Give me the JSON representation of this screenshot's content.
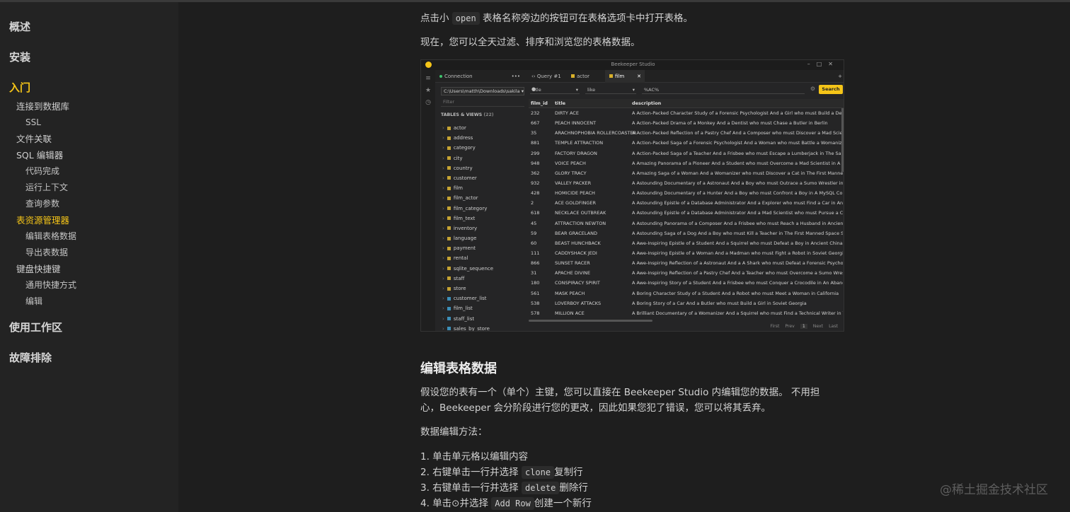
{
  "sidebar": {
    "sections": [
      {
        "label": "概述"
      },
      {
        "label": "安装"
      },
      {
        "label": "入门",
        "active": true
      }
    ],
    "intro_items": [
      {
        "label": "连接到数据库",
        "level": 1
      },
      {
        "label": "SSL",
        "level": 2
      },
      {
        "label": "文件关联",
        "level": 1
      },
      {
        "label": "SQL 编辑器",
        "level": 1
      },
      {
        "label": "代码完成",
        "level": 2
      },
      {
        "label": "运行上下文",
        "level": 2
      },
      {
        "label": "查询参数",
        "level": 2
      },
      {
        "label": "表资源管理器",
        "level": 1,
        "active": true
      },
      {
        "label": "编辑表格数据",
        "level": 2
      },
      {
        "label": "导出表数据",
        "level": 2
      },
      {
        "label": "键盘快捷键",
        "level": 1
      },
      {
        "label": "通用快捷方式",
        "level": 2
      },
      {
        "label": "编辑",
        "level": 2
      }
    ],
    "bottom_sections": [
      {
        "label": "使用工作区"
      },
      {
        "label": "故障排除"
      }
    ]
  },
  "content": {
    "p1_before": "点击小",
    "p1_code": "open",
    "p1_after": "表格名称旁边的按钮可在表格选项卡中打开表格。",
    "p2": "现在，您可以全天过滤、排序和浏览您的表格数据。",
    "heading": "编辑表格数据",
    "p3_line1": "假设您的表有一个（单个）主键，您可以直接在 Beekeeper Studio 内编辑您的数据。 不用担",
    "p3_line2": "心，Beekeeper 会分阶段进行您的更改，因此如果您犯了错误，您可以将其丢弃。",
    "p4": "数据编辑方法：",
    "list": {
      "i1": "1. 单击单元格以编辑内容",
      "i2_before": "2. 右键单击一行并选择",
      "i2_code": "clone",
      "i2_after": "复制行",
      "i3_before": "3. 右键单击一行并选择",
      "i3_code": "delete",
      "i3_after": "删除行",
      "i4_before": "4. 单击⊙并选择",
      "i4_code": "Add Row",
      "i4_after": "创建一个新行"
    }
  },
  "app": {
    "window_title": "Beekeeper Studio",
    "tabs": {
      "connection": "Connection",
      "more": "•••",
      "query": "‹› Query #1",
      "actor": "actor",
      "film": "film",
      "close": "✕",
      "plus": "+"
    },
    "path": "C:\\Users\\matth\\Downloads\\sakila",
    "filter_placeholder": "Filter",
    "tables_header": "TABLES & VIEWS",
    "tables_count": "(22)",
    "tables": [
      {
        "name": "actor",
        "view": false
      },
      {
        "name": "address",
        "view": false
      },
      {
        "name": "category",
        "view": false
      },
      {
        "name": "city",
        "view": false
      },
      {
        "name": "country",
        "view": false
      },
      {
        "name": "customer",
        "view": false
      },
      {
        "name": "film",
        "view": false
      },
      {
        "name": "film_actor",
        "view": false
      },
      {
        "name": "film_category",
        "view": false
      },
      {
        "name": "film_text",
        "view": false
      },
      {
        "name": "inventory",
        "view": false
      },
      {
        "name": "language",
        "view": false
      },
      {
        "name": "payment",
        "view": false
      },
      {
        "name": "rental",
        "view": false
      },
      {
        "name": "sqlite_sequence",
        "view": false
      },
      {
        "name": "staff",
        "view": false
      },
      {
        "name": "store",
        "view": false
      },
      {
        "name": "customer_list",
        "view": true
      },
      {
        "name": "film_list",
        "view": true
      },
      {
        "name": "staff_list",
        "view": true
      },
      {
        "name": "sales_by_store",
        "view": true
      }
    ],
    "query_bar": {
      "field": "title",
      "operator": "like",
      "value": "%AC%",
      "search_label": "Search"
    },
    "columns": [
      "film_id",
      "title",
      "description"
    ],
    "rows": [
      [
        "232",
        "DIRTY ACE",
        "A Action-Packed Character Study of a Forensic Psychologist And a Girl who must Build a Dentist in The Outback"
      ],
      [
        "667",
        "PEACH INNOCENT",
        "A Action-Packed Drama of a Monkey And a Dentist who must Chase a Butler in Berlin"
      ],
      [
        "35",
        "ARACHNOPHOBIA ROLLERCOASTER",
        "A Action-Packed Reflection of a Pastry Chef And a Composer who must Discover a Mad Scientist in The First Manned"
      ],
      [
        "881",
        "TEMPLE ATTRACTION",
        "A Action-Packed Saga of a Forensic Psychologist And a Woman who must Battle a Womanizer in Soviet Georgia"
      ],
      [
        "299",
        "FACTORY DRAGON",
        "A Action-Packed Saga of a Teacher And a Frisbee who must Escape a Lumberjack in The Sahara Desert"
      ],
      [
        "948",
        "VOICE PEACH",
        "A Amazing Panorama of a Pioneer And a Student who must Overcome a Mad Scientist in A Manhattan Penthouse"
      ],
      [
        "362",
        "GLORY TRACY",
        "A Amazing Saga of a Woman And a Womanizer who must Discover a Cat in The First Manned Space Station"
      ],
      [
        "932",
        "VALLEY PACKER",
        "A Astounding Documentary of a Astronaut And a Boy who must Outrace a Sumo Wrestler in Berlin"
      ],
      [
        "428",
        "HOMICIDE PEACH",
        "A Astounding Documentary of a Hunter And a Boy who must Confront a Boy in A MySQL Convention"
      ],
      [
        "2",
        "ACE GOLDFINGER",
        "A Astounding Epistle of a Database Administrator And a Explorer who must Find a Car in Ancient China"
      ],
      [
        "618",
        "NECKLACE OUTBREAK",
        "A Astounding Epistle of a Database Administrator And a Mad Scientist who must Pursue a Cat in California"
      ],
      [
        "45",
        "ATTRACTION NEWTON",
        "A Astounding Panorama of a Composer And a Frisbee who must Reach a Husband in Ancient Japan"
      ],
      [
        "59",
        "BEAR GRACELAND",
        "A Astounding Saga of a Dog And a Boy who must Kill a Teacher in The First Manned Space Station"
      ],
      [
        "60",
        "BEAST HUNCHBACK",
        "A Awe-Inspiring Epistle of a Student And a Squirrel who must Defeat a Boy in Ancient China"
      ],
      [
        "111",
        "CADDYSHACK JEDI",
        "A Awe-Inspiring Epistle of a Woman And a Madman who must Fight a Robot in Soviet Georgia"
      ],
      [
        "866",
        "SUNSET RACER",
        "A Awe-Inspiring Reflection of a Astronaut And a A Shark who must Defeat a Forensic Psychologist in California"
      ],
      [
        "31",
        "APACHE DIVINE",
        "A Awe-Inspiring Reflection of a Pastry Chef And a Teacher who must Overcome a Sumo Wrestler in A U-Boat"
      ],
      [
        "180",
        "CONSPIRACY SPIRIT",
        "A Awe-Inspiring Story of a Student And a Frisbee who must Conquer a Crocodile in An Abandoned Mine Shaft"
      ],
      [
        "561",
        "MASK PEACH",
        "A Boring Character Study of a Student And a Robot who must Meet a Woman in California"
      ],
      [
        "538",
        "LOVERBOY ATTACKS",
        "A Boring Story of a Car And a Butler who must Build a Girl in Soviet Georgia"
      ],
      [
        "578",
        "MILLION ACE",
        "A Brilliant Documentary of a Womanizer And a Squirrel who must Find a Technical Writer in The Sahara Desert"
      ]
    ],
    "pager": {
      "first": "First",
      "prev": "Prev",
      "page": "1",
      "next": "Next",
      "last": "Last"
    }
  },
  "watermark": "@稀土掘金技术社区",
  "colors": {
    "accent": "#f5c518",
    "background": "#1e1e1e",
    "sidebar": "#232323"
  }
}
